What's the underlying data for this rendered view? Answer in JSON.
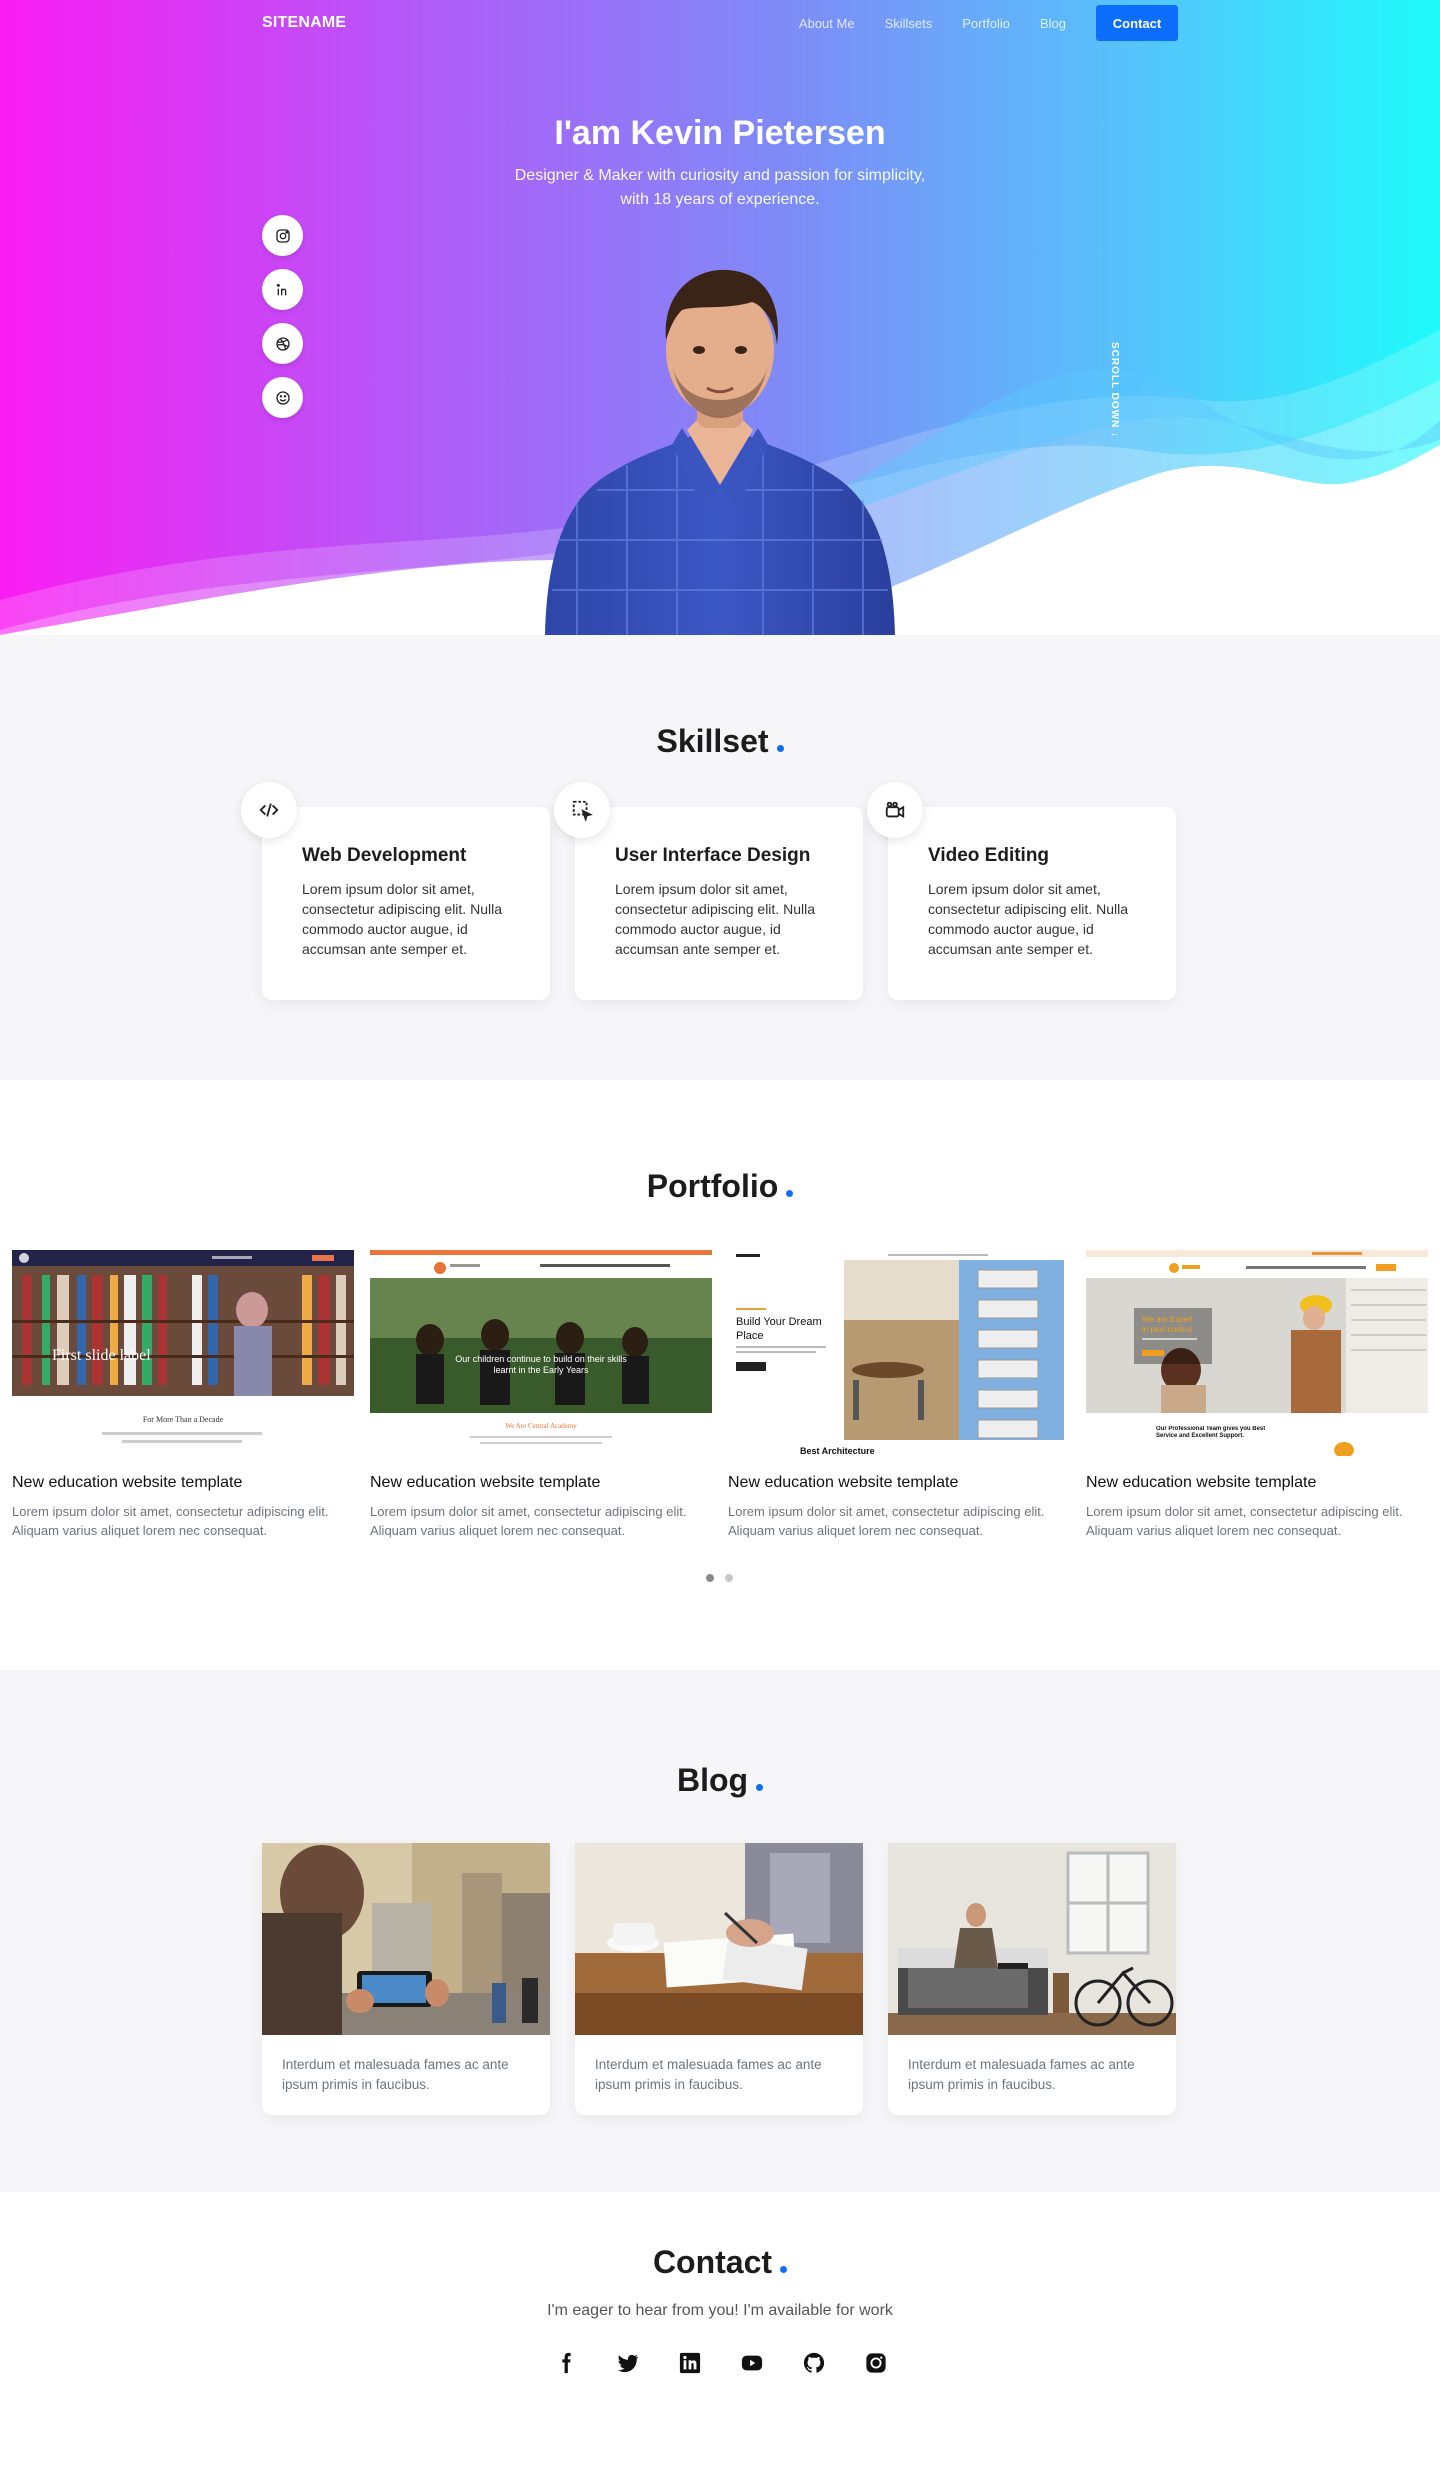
{
  "nav": {
    "logo": "SITENAME",
    "links": [
      "About Me",
      "Skillsets",
      "Portfolio",
      "Blog"
    ],
    "contact": "Contact"
  },
  "hero": {
    "title": "I'am Kevin Pietersen",
    "subtitle_line1": "Designer & Maker with curiosity and passion for simplicity,",
    "subtitle_line2": "with 18 years of experience.",
    "scroll_label": "SCROLL DOWN",
    "social_icons": [
      "instagram-icon",
      "linkedin-icon",
      "dribbble-icon",
      "smile-icon"
    ]
  },
  "skillset": {
    "title": "Skillset",
    "cards": [
      {
        "icon": "code-icon",
        "title": "Web Development",
        "text": "Lorem ipsum dolor sit amet, consectetur adipiscing elit. Nulla commodo auctor augue, id accumsan ante semper et."
      },
      {
        "icon": "select-pointer-icon",
        "title": "User Interface Design",
        "text": "Lorem ipsum dolor sit amet, consectetur adipiscing elit. Nulla commodo auctor augue, id accumsan ante semper et."
      },
      {
        "icon": "video-camera-icon",
        "title": "Video Editing",
        "text": "Lorem ipsum dolor sit amet, consectetur adipiscing elit. Nulla commodo auctor augue, id accumsan ante semper et."
      }
    ]
  },
  "portfolio": {
    "title": "Portfolio",
    "items": [
      {
        "title": "New education website template",
        "text": "Lorem ipsum dolor sit amet, consectetur adipiscing elit. Aliquam varius aliquet lorem nec consequat.",
        "thumb_heading": "First slide label",
        "thumb_caption": "For More Than a Decade"
      },
      {
        "title": "New education website template",
        "text": "Lorem ipsum dolor sit amet, consectetur adipiscing elit. Aliquam varius aliquet lorem nec consequat.",
        "thumb_heading": "Our children continue to build on their skills learnt in the Early Years",
        "thumb_caption": "We Are Central Academy"
      },
      {
        "title": "New education website template",
        "text": "Lorem ipsum dolor sit amet, consectetur adipiscing elit. Aliquam varius aliquet lorem nec consequat.",
        "thumb_heading": "Build Your Dream Place",
        "thumb_caption": "Best Architecture"
      },
      {
        "title": "New education website template",
        "text": "Lorem ipsum dolor sit amet, consectetur adipiscing elit. Aliquam varius aliquet lorem nec consequat.",
        "thumb_heading": "We are Expert in pest control",
        "thumb_caption": "Our Professional Team gives you Best Service and Excellent Support."
      }
    ],
    "pages": 2,
    "active_page": 1
  },
  "blog": {
    "title": "Blog",
    "cards": [
      {
        "text": "Interdum et malesuada fames ac ante ipsum primis in faucibus."
      },
      {
        "text": "Interdum et malesuada fames ac ante ipsum primis in faucibus."
      },
      {
        "text": "Interdum et malesuada fames ac ante ipsum primis in faucibus."
      }
    ]
  },
  "contact": {
    "title": "Contact",
    "subtitle": "I'm eager to hear from you! I'm available for work",
    "icons": [
      "facebook-icon",
      "twitter-icon",
      "linkedin-icon",
      "youtube-icon",
      "github-icon",
      "instagram-icon"
    ]
  },
  "colors": {
    "accent": "#0d6efd",
    "gradient_start": "#fb1cf3",
    "gradient_end": "#1efbfb"
  }
}
